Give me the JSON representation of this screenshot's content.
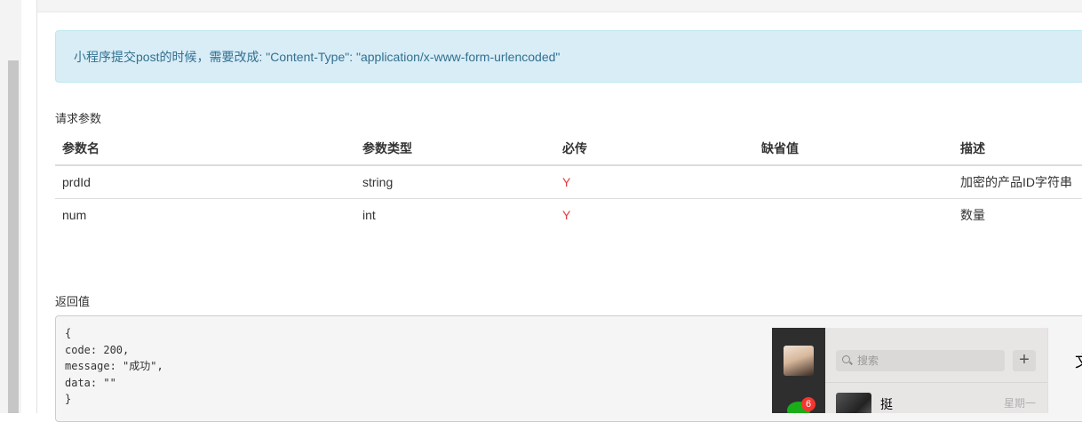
{
  "notice": "小程序提交post的时候，需要改成: \"Content-Type\": \"application/x-www-form-urlencoded\"",
  "params_section": {
    "title": "请求参数",
    "headers": [
      "参数名",
      "参数类型",
      "必传",
      "缺省值",
      "描述"
    ],
    "rows": [
      {
        "name": "prdId",
        "type": "string",
        "required": "Y",
        "default": "",
        "desc": "加密的产品ID字符串"
      },
      {
        "name": "num",
        "type": "int",
        "required": "Y",
        "default": "",
        "desc": "数量"
      }
    ]
  },
  "return_section": {
    "title": "返回值",
    "code_lines": [
      "{",
      "code: 200,",
      "message: \"成功\",",
      "data: \"\"",
      "}"
    ]
  },
  "wechat": {
    "search_placeholder": "搜索",
    "add_label": "+",
    "unread_badge": "6",
    "conversation": {
      "name": "挺",
      "time": "星期一"
    },
    "main_title_partial": "文"
  },
  "colors": {
    "alert_bg": "#d9edf7",
    "alert_text": "#31708f",
    "required": "#e4393c",
    "wechat_green": "#1aad19"
  }
}
